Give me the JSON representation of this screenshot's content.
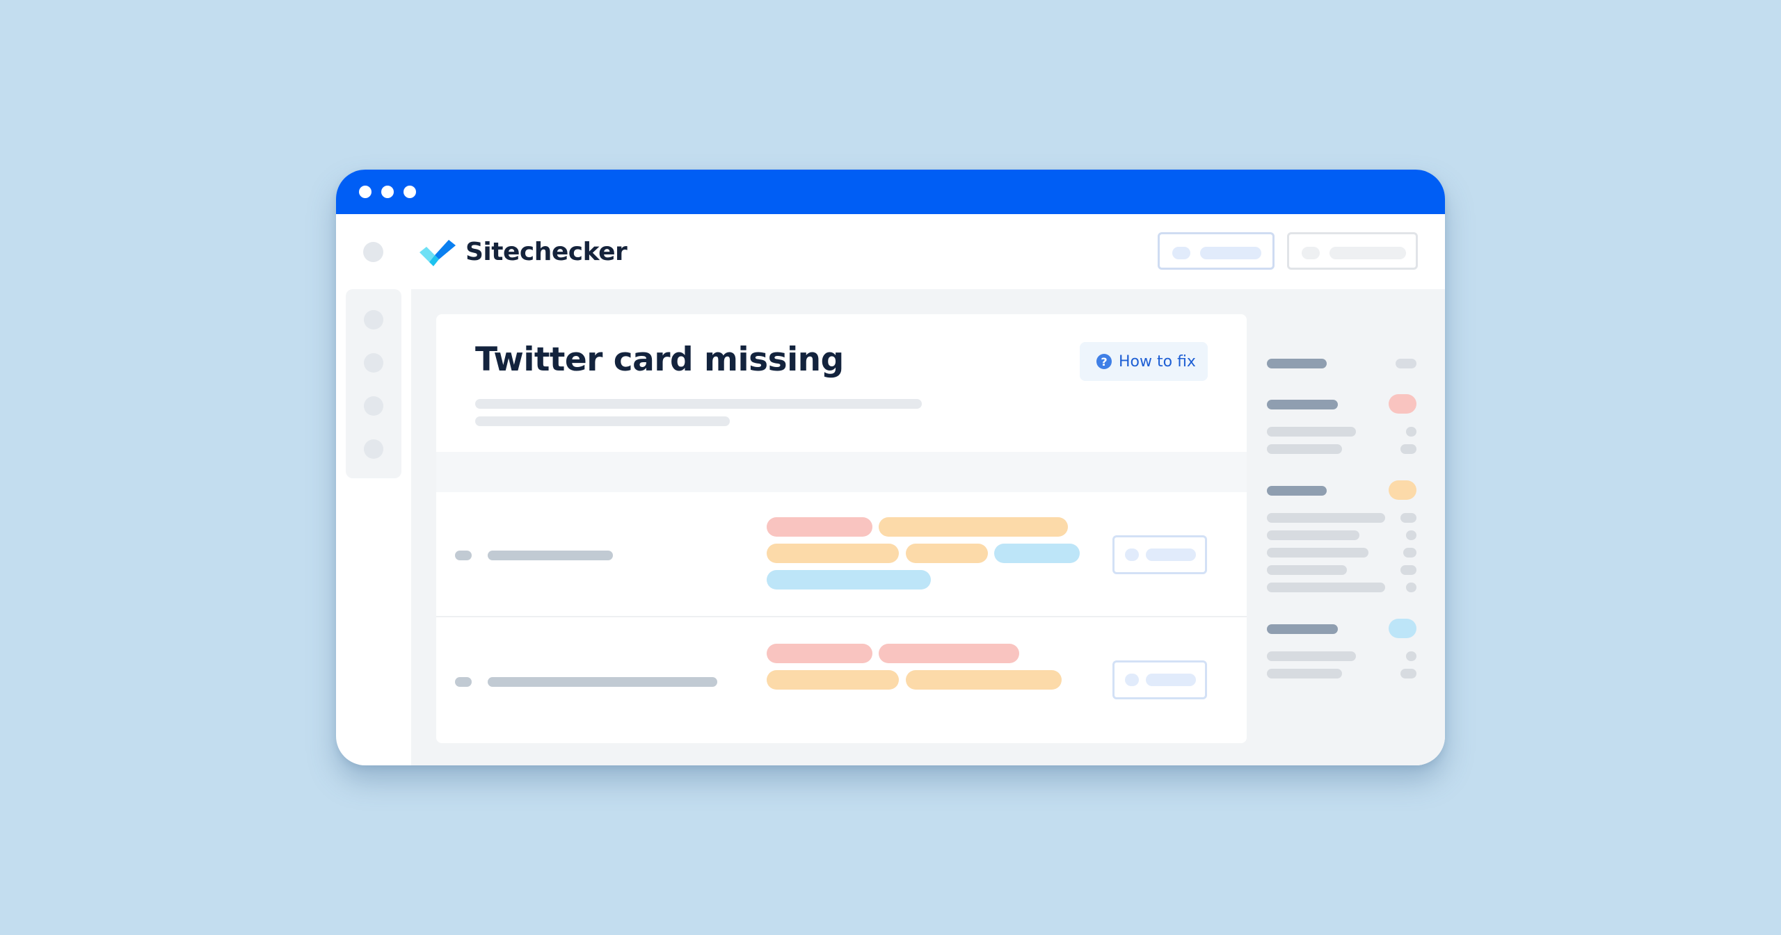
{
  "window": {
    "titlebar_color": "#005ef5",
    "window_controls": [
      "dot",
      "dot",
      "dot"
    ]
  },
  "brand": {
    "name": "Sitechecker",
    "logo_icon": "checkmark-logo-icon",
    "logo_colors": [
      "#6ee0f5",
      "#1dc2ef",
      "#0a7ff0"
    ]
  },
  "header_buttons": [
    {
      "style": "primary-outline",
      "border": "#cfdcf2",
      "fill": "#e1ebfb"
    },
    {
      "style": "secondary-outline",
      "border": "#e1e4e8",
      "fill": "#eef0f2"
    }
  ],
  "sidebar": {
    "items": [
      "nav-item",
      "nav-item",
      "nav-item",
      "nav-item"
    ]
  },
  "issue": {
    "title": "Twitter card missing",
    "how_to_fix": {
      "label": "How to fix",
      "icon": "question-circle-icon",
      "icon_glyph": "?"
    }
  },
  "colors": {
    "error": "#f9c4c0",
    "warning": "#fcdaa9",
    "notice": "#bde5f8",
    "placeholder_dark": "#c1cad3",
    "placeholder_light": "#e6e9ed",
    "title_text": "#13233d",
    "link_blue": "#1e5fd4"
  },
  "rows": [
    {
      "tags": [
        [
          "error",
          "warning"
        ],
        [
          "warning",
          "warning",
          "notice"
        ],
        [
          "notice"
        ]
      ]
    },
    {
      "tags": [
        [
          "error",
          "error"
        ],
        [
          "warning",
          "warning"
        ]
      ]
    }
  ],
  "right_panel": {
    "groups": [
      {
        "badge": "neutral",
        "items": 0
      },
      {
        "badge": "error",
        "items": 2
      },
      {
        "badge": "warning",
        "items": 5
      },
      {
        "badge": "notice",
        "items": 2
      }
    ]
  }
}
